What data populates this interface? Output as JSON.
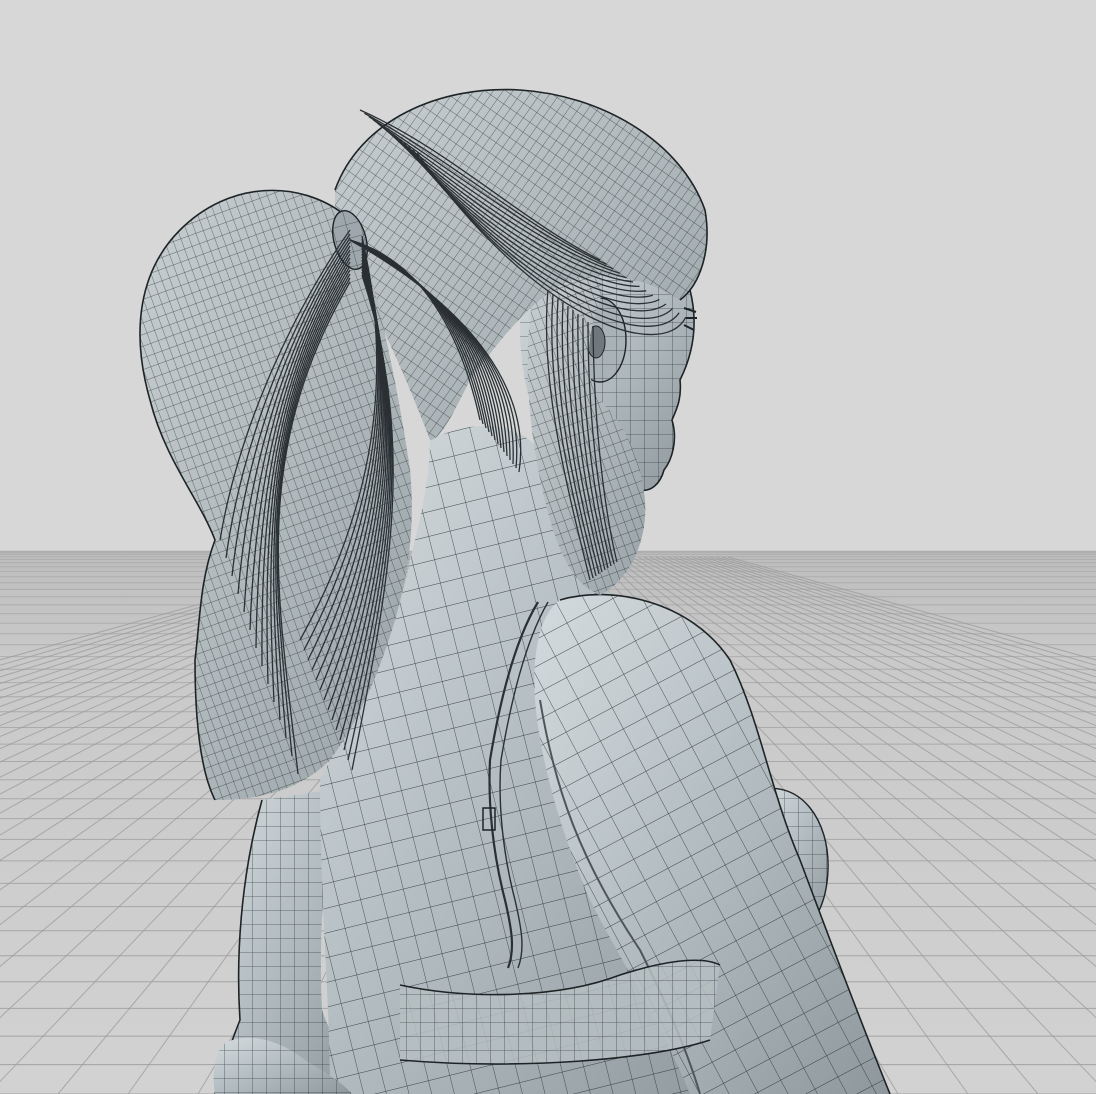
{
  "viewport": {
    "background_color": "#d7d7d7",
    "grid_color": "#9a9a9a",
    "mesh_fill": "#b9c2c6",
    "mesh_shade": "#8e989d",
    "mesh_highlight": "#d6dde0",
    "wire_color": "#1e2426"
  },
  "scene": {
    "subject": "wireframe-character-model",
    "display_mode": "shaded-with-wireframe",
    "ground": "perspective-grid-plane"
  }
}
